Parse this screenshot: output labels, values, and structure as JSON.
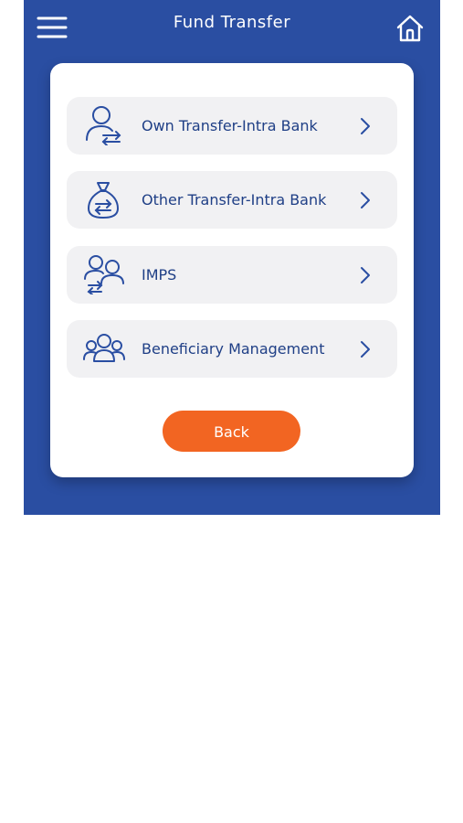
{
  "header": {
    "title": "Fund Transfer",
    "menu_icon": "hamburger-menu-icon",
    "home_icon": "home-icon"
  },
  "colors": {
    "brand_blue": "#2a4ea2",
    "label_blue": "#1f3f86",
    "accent_orange": "#f26522",
    "option_bg": "#f1f1f3"
  },
  "menu": {
    "items": [
      {
        "label": "Own Transfer-Intra Bank",
        "icon": "user-transfer-icon"
      },
      {
        "label": "Other Transfer-Intra Bank",
        "icon": "money-bag-transfer-icon"
      },
      {
        "label": "IMPS",
        "icon": "users-transfer-icon"
      },
      {
        "label": "Beneficiary Management",
        "icon": "group-users-icon"
      }
    ]
  },
  "actions": {
    "back_label": "Back"
  }
}
